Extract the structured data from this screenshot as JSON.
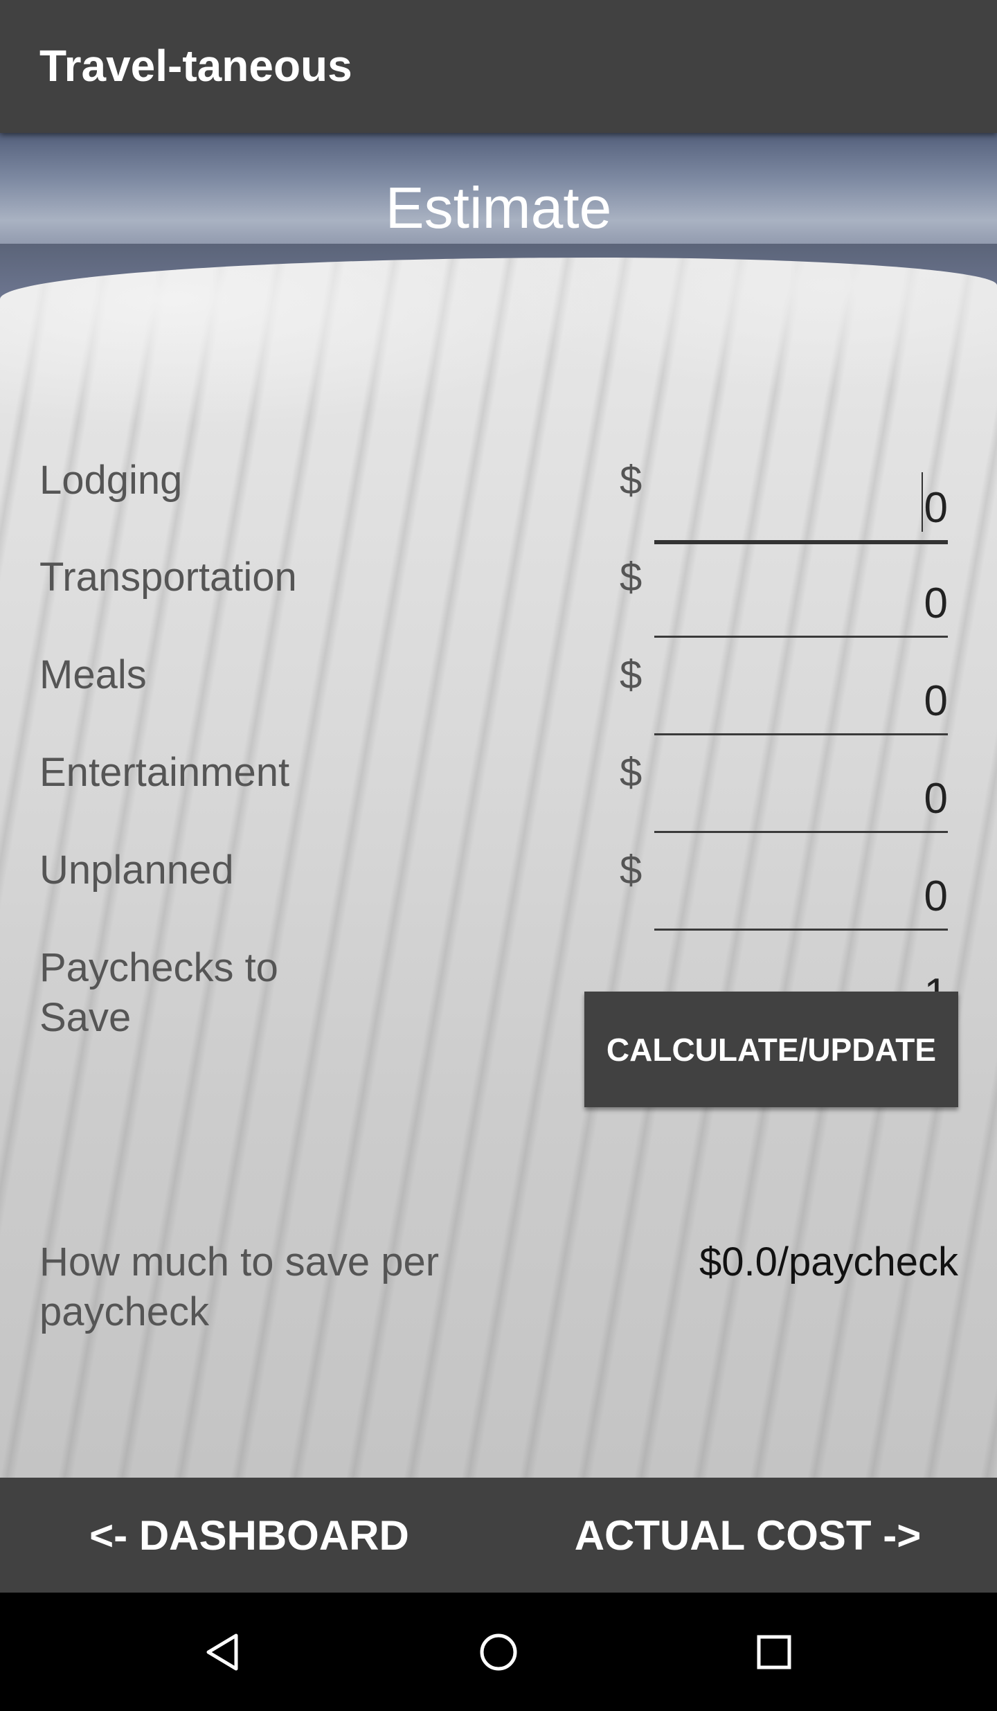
{
  "app": {
    "title": "Travel-taneous"
  },
  "screen": {
    "title": "Estimate"
  },
  "rows": [
    {
      "label": "Lodging",
      "currency": "$",
      "value": "0"
    },
    {
      "label": "Transportation",
      "currency": "$",
      "value": "0"
    },
    {
      "label": "Meals",
      "currency": "$",
      "value": "0"
    },
    {
      "label": "Entertainment",
      "currency": "$",
      "value": "0"
    },
    {
      "label": "Unplanned",
      "currency": "$",
      "value": "0"
    }
  ],
  "paychecks": {
    "label": "Paychecks to Save",
    "value": "1"
  },
  "calculate_button": {
    "label": "CALCULATE/UPDATE"
  },
  "result": {
    "label": "How much to save per paycheck",
    "value": "$0.0/paycheck"
  },
  "nav": {
    "dashboard": "<- DASHBOARD",
    "actual_cost": "ACTUAL COST ->"
  },
  "system_nav": {
    "back_icon": "back-triangle-icon",
    "home_icon": "home-circle-icon",
    "recents_icon": "recents-square-icon"
  },
  "colors": {
    "bar": "#414141",
    "system_bar": "#000000"
  }
}
